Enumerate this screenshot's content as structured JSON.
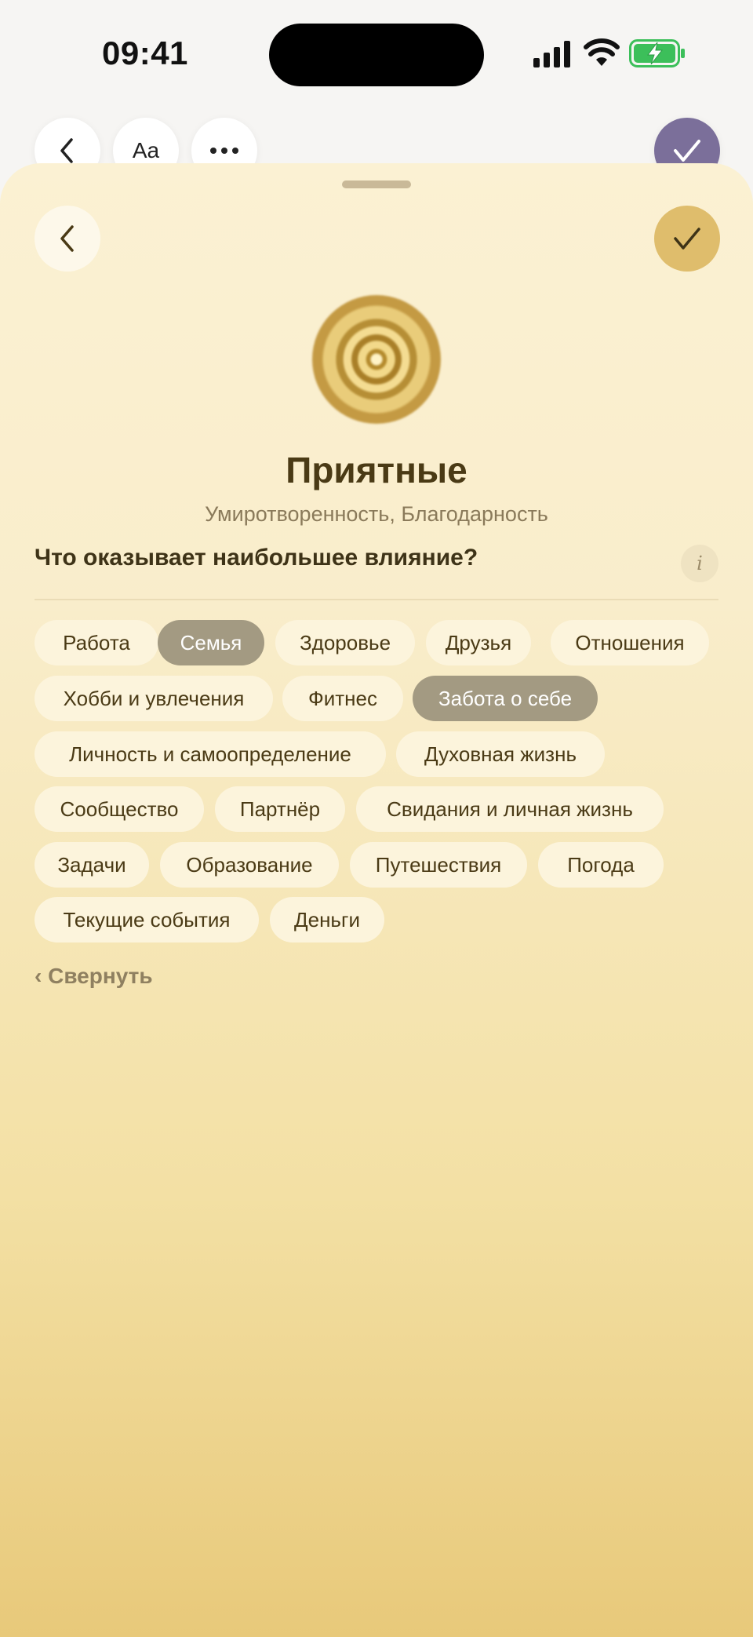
{
  "status_bar": {
    "time": "09:41"
  },
  "background_toolbar": {
    "font_button_label": "Aa"
  },
  "sheet": {
    "title": "Приятные",
    "subtitle": "Умиротворенность, Благодарность",
    "question": "Что оказывает наибольшее влияние?",
    "info_label": "i",
    "collapse_label": "‹ Свернуть",
    "chips": [
      {
        "label": "Работа",
        "selected": false
      },
      {
        "label": "Семья",
        "selected": true
      },
      {
        "label": "Здоровье",
        "selected": false
      },
      {
        "label": "Друзья",
        "selected": false
      },
      {
        "label": "Отношения",
        "selected": false
      },
      {
        "label": "Хобби и увлечения",
        "selected": false
      },
      {
        "label": "Фитнес",
        "selected": false
      },
      {
        "label": "Забота о себе",
        "selected": true
      },
      {
        "label": "Личность и самоопределение",
        "selected": false
      },
      {
        "label": "Духовная жизнь",
        "selected": false
      },
      {
        "label": "Сообщество",
        "selected": false
      },
      {
        "label": "Партнёр",
        "selected": false
      },
      {
        "label": "Свидания и личная жизнь",
        "selected": false
      },
      {
        "label": "Задачи",
        "selected": false
      },
      {
        "label": "Образование",
        "selected": false
      },
      {
        "label": "Путешествия",
        "selected": false
      },
      {
        "label": "Погода",
        "selected": false
      },
      {
        "label": "Текущие события",
        "selected": false
      },
      {
        "label": "Деньги",
        "selected": false
      }
    ]
  },
  "colors": {
    "selected_chip": "#a39a82",
    "chip": "#fcf4dc",
    "confirm": "#dfbd6c",
    "accent_purple": "#7b6f9a"
  }
}
